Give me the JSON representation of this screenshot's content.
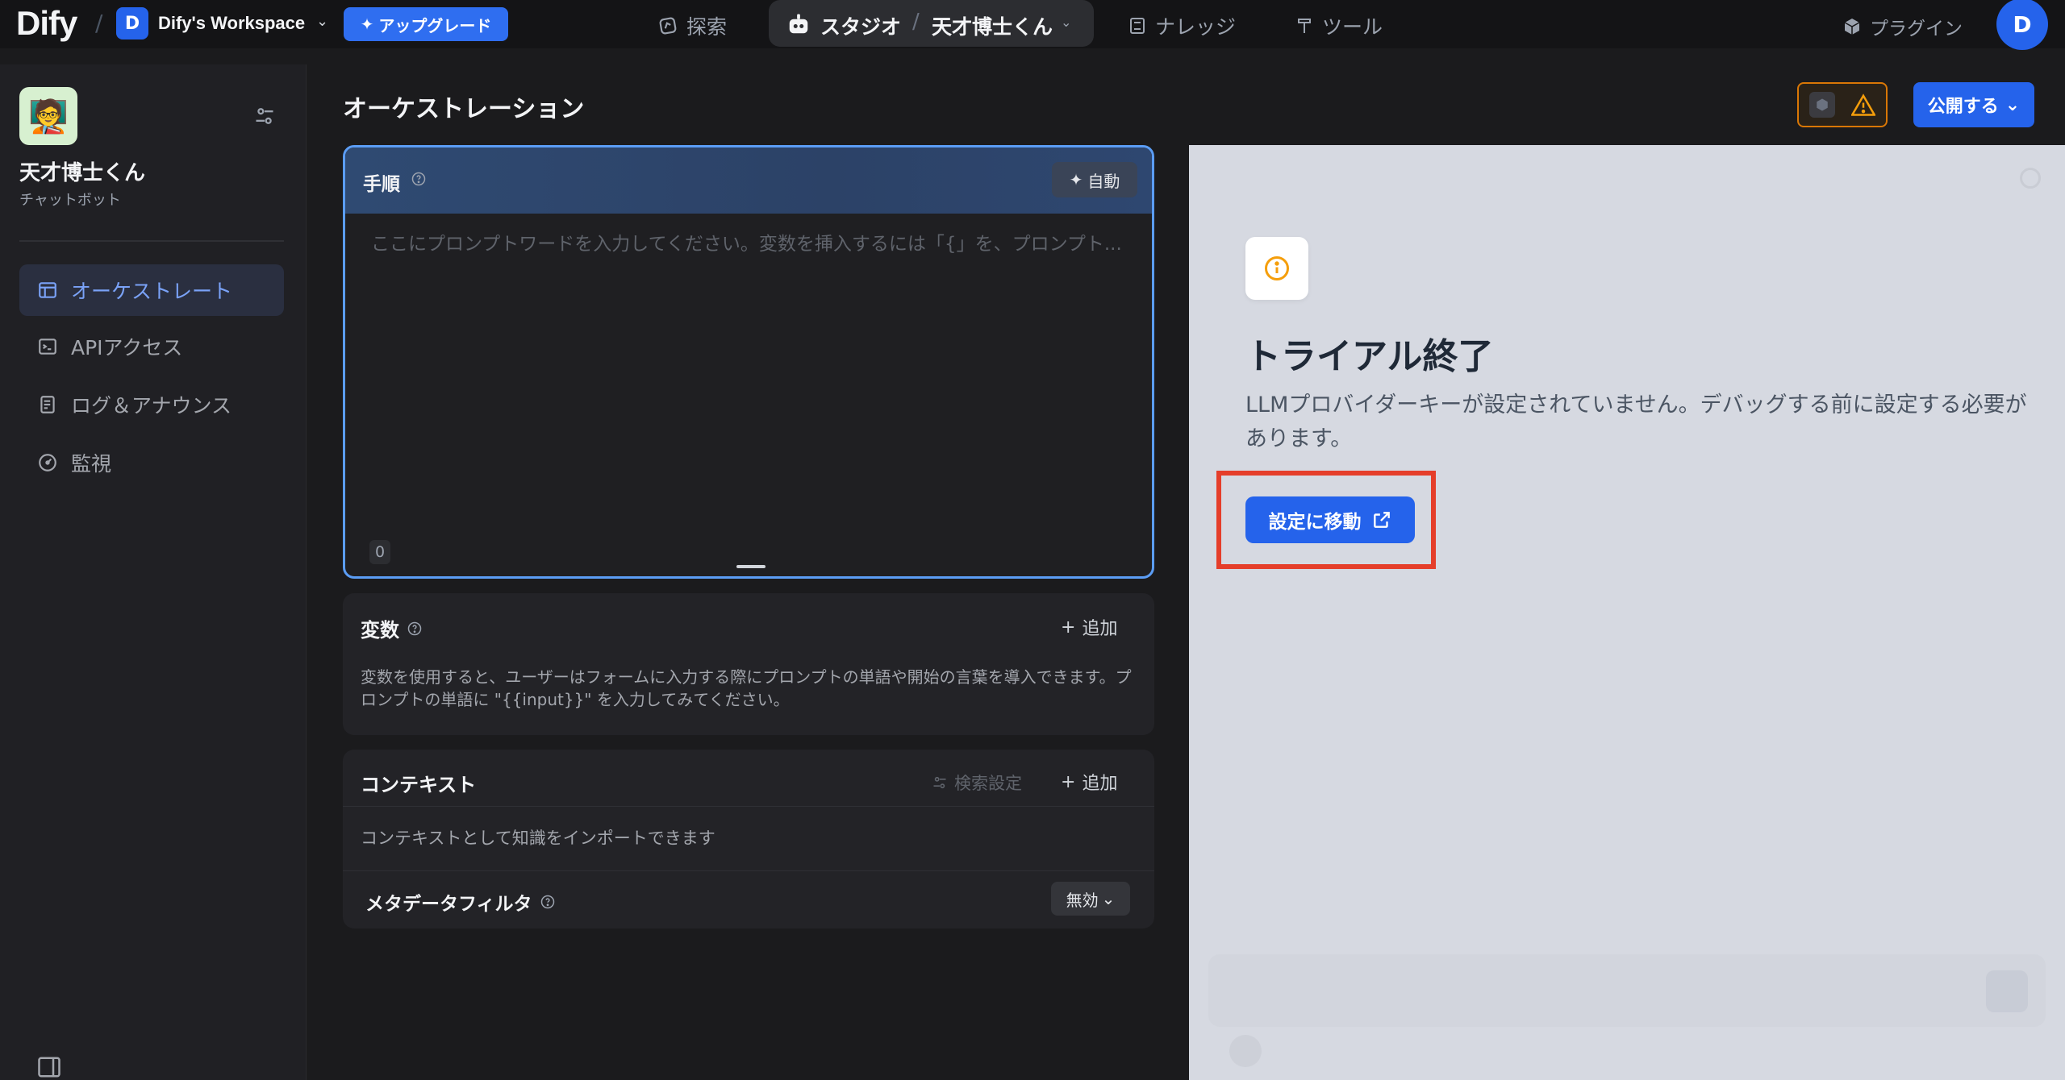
{
  "header": {
    "logo": "Dify",
    "workspace_initial": "D",
    "workspace_name": "Dify's Workspace",
    "upgrade_label": "アップグレード",
    "nav": {
      "explore": "探索",
      "studio": "スタジオ",
      "app_name": "天才博士くん",
      "knowledge": "ナレッジ",
      "tools": "ツール",
      "plugins": "プラグイン"
    },
    "user_initial": "D"
  },
  "sidebar": {
    "app_icon": "🧑‍🏫",
    "app_name": "天才博士くん",
    "app_type": "チャットボット",
    "items": [
      {
        "label": "オーケストレート",
        "icon": "window-icon",
        "active": true
      },
      {
        "label": "APIアクセス",
        "icon": "terminal-icon",
        "active": false
      },
      {
        "label": "ログ＆アナウンス",
        "icon": "document-icon",
        "active": false
      },
      {
        "label": "監視",
        "icon": "gauge-icon",
        "active": false
      }
    ]
  },
  "main": {
    "title": "オーケストレーション",
    "publish_label": "公開する",
    "prompt": {
      "title": "手順",
      "auto_label": "自動",
      "placeholder": "ここにプロンプトワードを入力してください。変数を挿入するには「{」を、プロンプト...",
      "char_count": "0"
    },
    "variables": {
      "title": "変数",
      "add_label": "追加",
      "description": "変数を使用すると、ユーザーはフォームに入力する際にプロンプトの単語や開始の言葉を導入できます。プロンプトの単語に \"{{input}}\" を入力してみてください。"
    },
    "context": {
      "title": "コンテキスト",
      "search_settings_label": "検索設定",
      "add_label": "追加",
      "description": "コンテキストとして知識をインポートできます",
      "metadata_filter_label": "メタデータフィルタ",
      "metadata_filter_value": "無効"
    }
  },
  "debug": {
    "notice_title": "トライアル終了",
    "notice_desc": "LLMプロバイダーキーが設定されていません。デバッグする前に設定する必要があります。",
    "goto_settings_label": "設定に移動"
  },
  "colors": {
    "accent": "#2563eb",
    "warning": "#d97706",
    "highlight": "#e53e2a"
  }
}
